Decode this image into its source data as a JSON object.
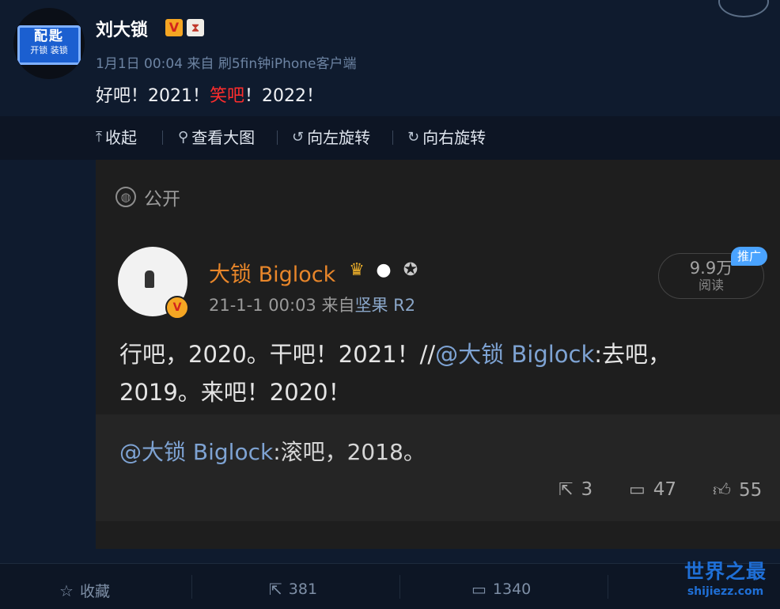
{
  "post": {
    "author": "刘大锁",
    "badge_v": "V",
    "badge_hourglass": "⧗",
    "avatar_sign": {
      "line1": "配匙",
      "line2": "开锁 装锁"
    },
    "meta": "1月1日 00:04 来自 刷5fin钟iPhone客户端",
    "text_parts": [
      "好吧！2021！",
      "笑吧",
      "！2022！"
    ]
  },
  "media_toolbar": {
    "collapse": "收起",
    "view_large": "查看大图",
    "rotate_left": "向左旋转",
    "rotate_right": "向右旋转"
  },
  "screenshot": {
    "visibility": "公开",
    "author": "大锁 Biglock",
    "meta_time": "21-1-1 00:03 来自",
    "meta_source": "坚果 R2",
    "reads_count": "9.9万",
    "reads_label": "阅读",
    "promo": "推广",
    "body_plain_1": "行吧，2020。干吧！2021！//",
    "body_at": "@大锁 Biglock",
    "body_plain_2": ":去吧，",
    "body_line2": "2019。来吧！2020！",
    "repost_at": "@大锁 Biglock",
    "repost_text": ":滚吧，2018。",
    "shares": "3",
    "comments": "47",
    "likes": "55"
  },
  "footer": {
    "favorite": "收藏",
    "reposts": "381",
    "comments": "1340"
  },
  "watermark": {
    "line1": "世界之最",
    "line2": "shijiezz.com"
  },
  "colors": {
    "background": "#0f1b2e",
    "accent_red": "#ff2d2d",
    "name_orange": "#e8862a",
    "link_blue": "#7ea3d3"
  }
}
